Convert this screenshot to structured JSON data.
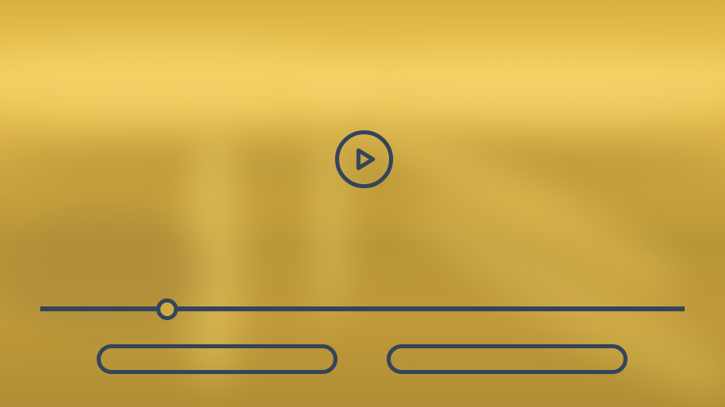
{
  "player": {
    "background_icon": "bridge-photo",
    "progress_fraction": 0.197,
    "play_icon": "play-icon"
  },
  "controls": {
    "left_button_label": "",
    "right_button_label": ""
  },
  "colors": {
    "overlay": "#d4af3f",
    "controls": "#34445c"
  }
}
